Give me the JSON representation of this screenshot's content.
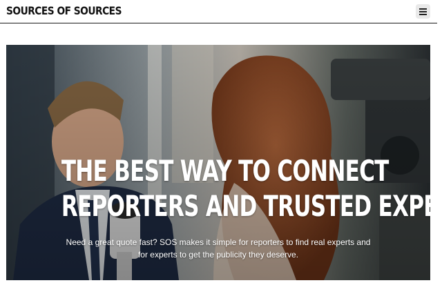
{
  "header": {
    "brand": "SOURCES OF SOURCES",
    "menu_icon": "hamburger-menu-icon"
  },
  "hero": {
    "title_line1": "THE BEST WAY TO CONNECT",
    "title_line2": "REPORTERS AND TRUSTED EXPERTS",
    "subtitle": "Need a great quote fast? SOS makes it simple for reporters to find real experts and for experts to get the publicity they deserve.",
    "photo_description_icon": "interview-photo"
  },
  "colors": {
    "header_bg": "#ffffff",
    "brand_text": "#111111",
    "hero_text": "#ffffff",
    "menu_button_bg": "#e9e9e9"
  }
}
